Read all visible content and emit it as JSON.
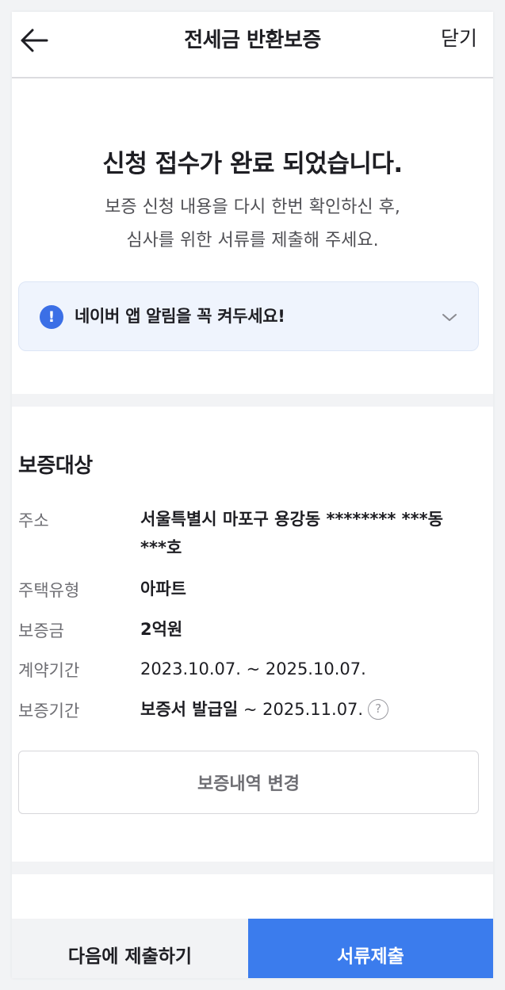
{
  "header": {
    "title": "전세금 반환보증",
    "close_label": "닫기"
  },
  "intro": {
    "title": "신청 접수가 완료 되었습니다.",
    "desc_line1": "보증 신청 내용을 다시 한번 확인하신 후,",
    "desc_line2": "심사를 위한 서류를 제출해 주세요."
  },
  "notice": {
    "icon_glyph": "!",
    "text": "네이버 앱 알림을 꼭 켜두세요!"
  },
  "guarantee": {
    "section_title": "보증대상",
    "address_label": "주소",
    "address_value": "서울특별시 마포구 용강동 ******** ***동 ***호",
    "house_type_label": "주택유형",
    "house_type_value": "아파트",
    "deposit_label": "보증금",
    "deposit_value": "2억원",
    "contract_period_label": "계약기간",
    "contract_period_value": "2023.10.07. ~ 2025.10.07.",
    "guarantee_period_label": "보증기간",
    "guarantee_period_start": "보증서 발급일",
    "guarantee_period_end": " ~ 2025.11.07.",
    "help_glyph": "?",
    "change_button_label": "보증내역 변경"
  },
  "bottom": {
    "later_label": "다음에 제출하기",
    "submit_label": "서류제출"
  },
  "colors": {
    "accent": "#3b7ced",
    "notice_bg": "#eff4fd",
    "notice_icon": "#3b6fe6"
  },
  "icons": {
    "back": "arrow-left-icon",
    "notice": "exclamation-circle-icon",
    "chevron": "chevron-down-icon",
    "help": "question-circle-icon"
  }
}
